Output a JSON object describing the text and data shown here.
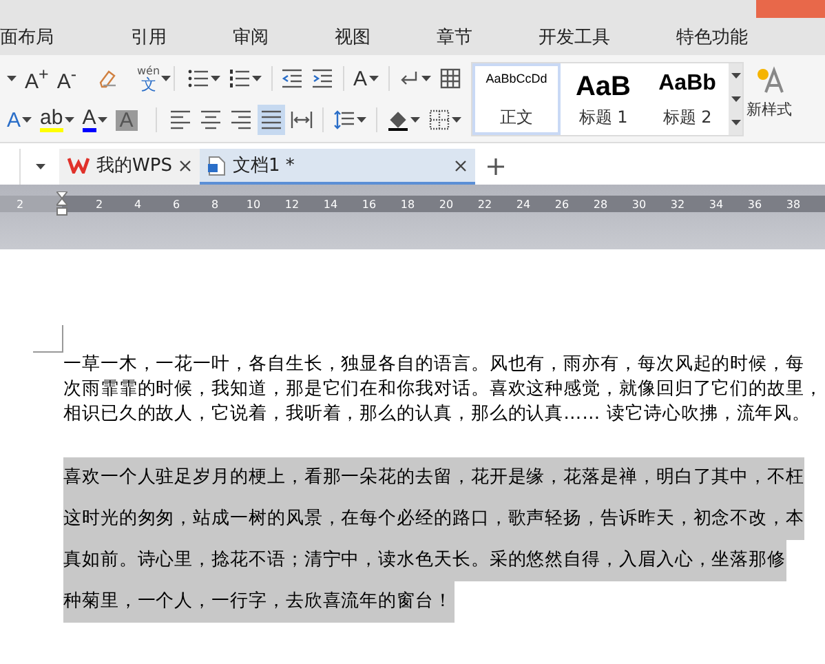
{
  "menu_tabs": [
    {
      "label": "面布局",
      "selected": false
    },
    {
      "label": "引用",
      "selected": false
    },
    {
      "label": "审阅",
      "selected": false
    },
    {
      "label": "视图",
      "selected": false
    },
    {
      "label": "章节",
      "selected": false
    },
    {
      "label": "开发工具",
      "selected": false
    },
    {
      "label": "特色功能",
      "selected": false
    }
  ],
  "toolbar_rows": [
    [
      {
        "kind": "caret",
        "selected": false
      },
      {
        "kind": "glyph",
        "glyph": "A$^{+}$",
        "selected": false
      },
      {
        "kind": "glyph",
        "glyph": "A$^{-}$",
        "selected": false
      },
      {
        "kind": "sep"
      },
      {
        "kind": "eraser",
        "selected": false
      },
      {
        "kind": "sep"
      },
      {
        "kind": "pinyin",
        "glyph": "文",
        "note": "wén",
        "dropdown": true,
        "selected": false
      },
      {
        "kind": "group"
      },
      {
        "kind": "bullets",
        "dropdown": true,
        "selected": false
      },
      {
        "kind": "numbers",
        "dropdown": true,
        "selected": false
      },
      {
        "kind": "sep"
      },
      {
        "kind": "outdent",
        "selected": false
      },
      {
        "kind": "indent",
        "selected": false
      },
      {
        "kind": "sep"
      },
      {
        "kind": "glyph",
        "glyph": "A",
        "dropdown": true,
        "selected": false
      },
      {
        "kind": "sep"
      },
      {
        "kind": "linebreak",
        "dropdown": true,
        "selected": false
      },
      {
        "kind": "table",
        "selected": false
      }
    ],
    [
      {
        "kind": "outline-glyph",
        "glyph": "A",
        "dropdown": true,
        "selected": false
      },
      {
        "kind": "underlined",
        "glyph": "ab",
        "color": "#ffff00",
        "dropdown": true,
        "selected": false
      },
      {
        "kind": "underlined",
        "glyph": "A",
        "color": "#0000ff",
        "dropdown": true,
        "selected": false
      },
      {
        "kind": "shaded-glyph",
        "glyph": "A",
        "selected": false
      },
      {
        "kind": "group"
      },
      {
        "kind": "align-left",
        "selected": false
      },
      {
        "kind": "align-center",
        "selected": false
      },
      {
        "kind": "align-right",
        "selected": false
      },
      {
        "kind": "justify",
        "selected": true
      },
      {
        "kind": "distribute",
        "selected": false
      },
      {
        "kind": "sep"
      },
      {
        "kind": "line-spacing",
        "dropdown": true,
        "selected": false
      },
      {
        "kind": "sep"
      },
      {
        "kind": "fill",
        "dropdown": true,
        "selected": false
      },
      {
        "kind": "borders",
        "dropdown": true,
        "selected": false
      }
    ]
  ],
  "styles": [
    {
      "preview": "AaBbCcDd",
      "name": "正文",
      "selected": true,
      "kind": "body"
    },
    {
      "preview": "AaB",
      "name": "标题 1",
      "selected": false,
      "kind": "h1"
    },
    {
      "preview": "AaBb",
      "name": "标题 2",
      "selected": false,
      "kind": "h2"
    }
  ],
  "new_style": "新样式",
  "doc_tabs": [
    {
      "label": "我的WPS",
      "selected": false,
      "kind": "home"
    },
    {
      "label": "文档1 *",
      "selected": true,
      "kind": "doc"
    }
  ],
  "ruler_ticks": [
    "2",
    "2",
    "4",
    "6",
    "8",
    "10",
    "12",
    "14",
    "16",
    "18",
    "20",
    "22",
    "24",
    "26",
    "28",
    "30",
    "32",
    "34",
    "36",
    "38"
  ],
  "paragraphs": [
    {
      "highlighted": false,
      "lines": [
        "一草一木，一花一叶，各自生长，独显各自的语言。风也有，雨亦有，每次风起的时候，每",
        "次雨霏霏的时候，我知道，那是它们在和你我对话。喜欢这种感觉，就像回归了它们的故里，",
        "相识已久的故人，它说着，我听着，那么的认真，那么的认真…… 读它诗心吹拂，流年风。"
      ]
    },
    {
      "highlighted": true,
      "lines": [
        "喜欢一个人驻足岁月的梗上，看那一朵花的去留，花开是缘，花落是禅，明白了其中，不枉",
        "这时光的匆匆，站成一树的风景，在每个必经的路口，歌声轻扬，告诉昨天，初念不改，本",
        "真如前。诗心里，捻花不语；清宁中，读水色天长。采的悠然自得，入眉入心，坐落那修",
        "种菊里，一个人，一行字，去欣喜流年的窗台！"
      ]
    }
  ]
}
